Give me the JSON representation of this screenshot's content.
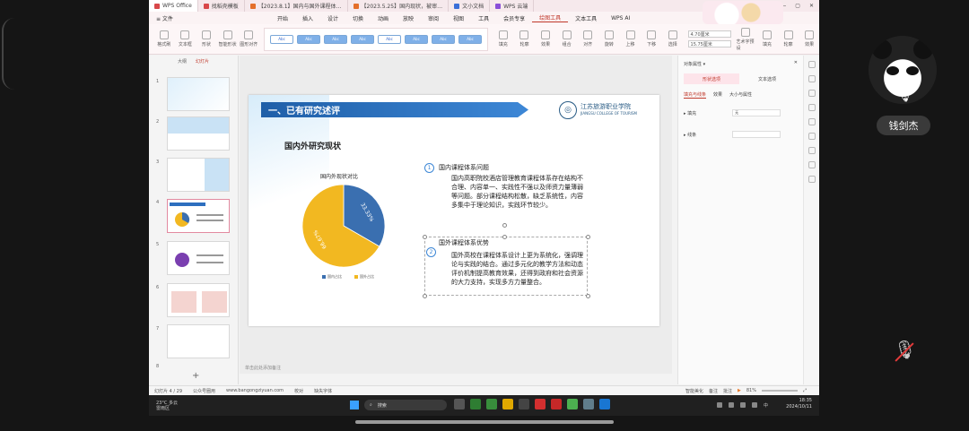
{
  "tabs": [
    {
      "label": "WPS Office",
      "color": "#d8484a"
    },
    {
      "label": "找稻壳模板",
      "color": "#d8484a"
    },
    {
      "label": "【2023.8.1】国内与国外课程体…",
      "color": "#e46f2a"
    },
    {
      "label": "【2023.5.25】国内现状，被审…",
      "color": "#e46f2a"
    },
    {
      "label": "文小文档",
      "color": "#3b6fd8"
    },
    {
      "label": "WPS 云端",
      "color": "#8a4fd8"
    }
  ],
  "menu": [
    "≡ 文件",
    "开始",
    "插入",
    "设计",
    "切换",
    "动画",
    "放映",
    "审阅",
    "视图",
    "工具",
    "会员专享",
    "绘图工具",
    "文本工具",
    "WPS AI"
  ],
  "menu_active": "绘图工具",
  "ribbon": {
    "left_buttons": [
      "格式刷",
      "文本框",
      "形状",
      "智能形状",
      "图形对齐"
    ],
    "style_swatches": [
      "Abc",
      "Abc",
      "Abc",
      "Abc",
      "Abc",
      "Abc",
      "Abc",
      "Abc"
    ],
    "mid_buttons": [
      "填充",
      "轮廓",
      "效果",
      "组合",
      "对齐",
      "旋转",
      "上移",
      "下移",
      "选择"
    ],
    "width_value": "4.70厘米",
    "height_value": "15.75厘米",
    "right_buttons": [
      "艺术字预设",
      "填充",
      "轮廓",
      "效果"
    ]
  },
  "thumbs": {
    "tabs": [
      "大纲",
      "幻灯片"
    ],
    "slides": [
      "1",
      "2",
      "3",
      "4",
      "5",
      "6",
      "7",
      "8"
    ],
    "add_label": "+"
  },
  "slide": {
    "banner": "一、已有研究述评",
    "logo_cn": "江苏旅游职业学院",
    "logo_en": "JIANGSU COLLEGE OF TOURISM",
    "page_title": "国内外研究现状",
    "chart_title": "国内外现状对比",
    "section1_num": "1",
    "section1_title": "国内课程体系问题",
    "section1_body": "国内高职院校酒店管理教育课程体系存在结构不合理、内容单一、实践性不强以及师资力量薄弱等问题。部分课程结构松散，缺乏系统性，内容多集中于理论知识，实践环节较少。",
    "section2_num": "2",
    "section2_title": "国外课程体系优势",
    "section2_body": "国外高校在课程体系设计上更为系统化，强调理论与实践的结合。通过多元化的教学方法和动态评价机制提高教育效果，还得到政府和社会资源的大力支持，实现多方力量整合。",
    "notes_placeholder": "单击此处添加备注"
  },
  "chart_data": {
    "type": "pie",
    "title": "国内外现状对比",
    "labels": [
      "国内占比",
      "国外占比"
    ],
    "values": [
      33.33,
      66.67
    ],
    "value_labels": [
      "33.33%",
      "66.67%"
    ],
    "colors": [
      "#3a6fb0",
      "#f2b821"
    ]
  },
  "right_panel": {
    "title": "对象属性 ▾",
    "tabs": [
      "形状选项",
      "文本选项"
    ],
    "subtabs": [
      "填充与线条",
      "效果",
      "大小与属性"
    ],
    "row1_label": "▸ 填充",
    "row1_value": "无",
    "row2_label": "▸ 线条",
    "row2_value": ""
  },
  "status": {
    "slide_counter": "幻灯片 4 / 29",
    "font_note": "公众号圈用",
    "url": "www.bangongziyuan.com",
    "check": "校对",
    "missing_font": "缺失字体",
    "beautify": "智能美化",
    "notes": "备注",
    "comment": "批注",
    "zoom": "81%"
  },
  "taskbar": {
    "weather_temp": "23°C 多云",
    "weather_desc": "雷雨区",
    "search_placeholder": "搜索",
    "lang": "中",
    "time": "18:35",
    "date": "2024/10/11"
  },
  "participant_name": "钱剑杰"
}
